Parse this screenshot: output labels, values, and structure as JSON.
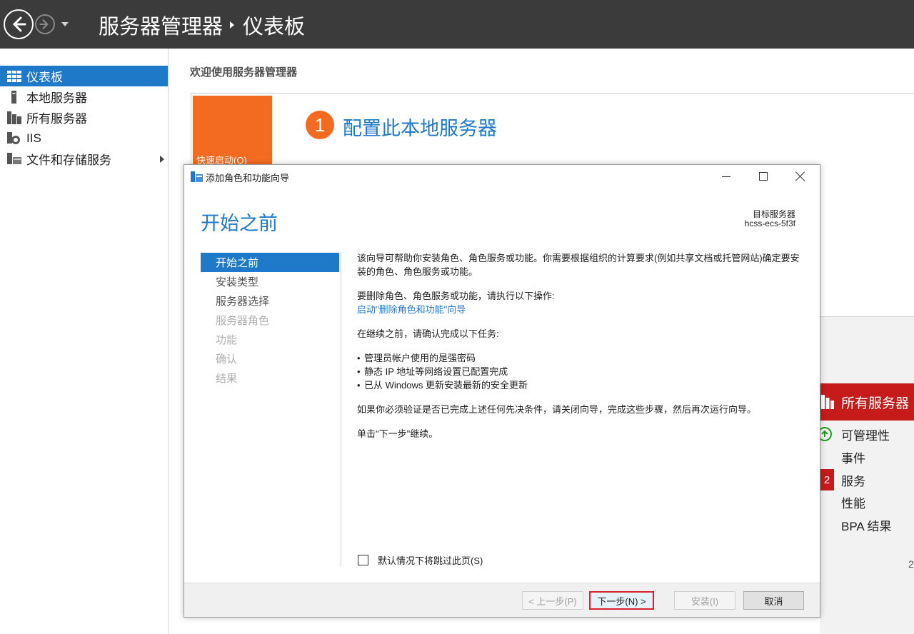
{
  "topbar": {
    "app_title": "服务器管理器",
    "page_title": "仪表板",
    "icons": [
      "back-arrow-icon",
      "forward-arrow-icon",
      "dropdown-caret-icon"
    ]
  },
  "sidebar": {
    "items": [
      {
        "label": "仪表板",
        "icon": "dashboard-grid-icon",
        "active": true
      },
      {
        "label": "本地服务器",
        "icon": "server-icon"
      },
      {
        "label": "所有服务器",
        "icon": "servers-icon"
      },
      {
        "label": "IIS",
        "icon": "iis-icon"
      },
      {
        "label": "文件和存储服务",
        "icon": "storage-icon",
        "has_submenu": true
      }
    ]
  },
  "main": {
    "welcome": "欢迎使用服务器管理器",
    "quick_start_label": "快速启动(Q)",
    "step_number": "1",
    "step_title": "配置此本地服务器",
    "all_servers": {
      "title": "所有服务器",
      "rows": [
        "可管理性",
        "事件",
        "服务",
        "性能",
        "BPA 结果"
      ],
      "services_count": "2",
      "edge_digit": "2"
    }
  },
  "dialog": {
    "title": "添加角色和功能向导",
    "heading": "开始之前",
    "target_label": "目标服务器",
    "target_value": "hcss-ecs-5f3f",
    "steps": [
      {
        "label": "开始之前",
        "state": "active"
      },
      {
        "label": "安装类型",
        "state": "enabled"
      },
      {
        "label": "服务器选择",
        "state": "enabled"
      },
      {
        "label": "服务器角色",
        "state": "disabled"
      },
      {
        "label": "功能",
        "state": "disabled"
      },
      {
        "label": "确认",
        "state": "disabled"
      },
      {
        "label": "结果",
        "state": "disabled"
      }
    ],
    "content": {
      "intro": "该向导可帮助你安装角色、角色服务或功能。你需要根据组织的计算要求(例如共享文档或托管网站)确定要安装的角色、角色服务或功能。",
      "remove_text": "要删除角色、角色服务或功能，请执行以下操作:",
      "remove_link": "启动\"删除角色和功能\"向导",
      "before_text": "在继续之前，请确认完成以下任务:",
      "tasks": [
        "管理员帐户使用的是强密码",
        "静态 IP 地址等网络设置已配置完成",
        "已从 Windows 更新安装最新的安全更新"
      ],
      "verify_text": "如果你必须验证是否已完成上述任何先决条件，请关闭向导，完成这些步骤，然后再次运行向导。",
      "next_hint": "单击\"下一步\"继续。"
    },
    "skip_checkbox_label": "默认情况下将跳过此页(S)",
    "skip_checked": false,
    "buttons": {
      "prev": "< 上一步(P)",
      "next": "下一步(N) >",
      "install": "安装(I)",
      "cancel": "取消"
    }
  },
  "colors": {
    "accent_blue": "#1e79c9",
    "orange": "#f36b21",
    "alert_red": "#c51b1b",
    "topbar": "#3b3b3b"
  }
}
